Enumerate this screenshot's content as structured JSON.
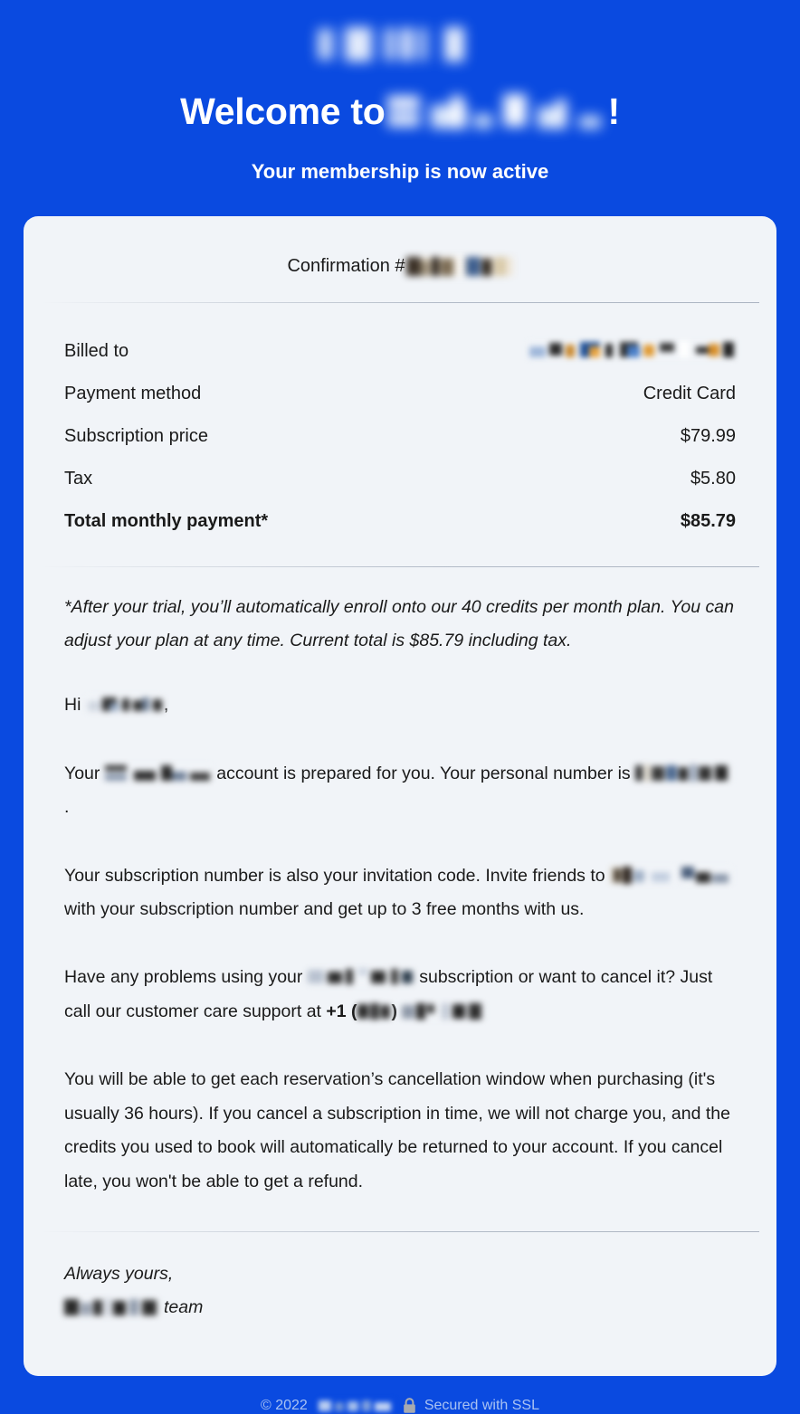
{
  "header": {
    "logo_alt": "brand-logo-redacted",
    "welcome_prefix": "Welcome to ",
    "brand_name_redacted": "",
    "welcome_suffix": "!",
    "subtitle": "Your membership is now active"
  },
  "card": {
    "confirmation_label": "Confirmation #",
    "confirmation_number_redacted": "",
    "billing": {
      "rows": [
        {
          "label": "Billed to",
          "value": "",
          "redacted": true,
          "bold": false
        },
        {
          "label": "Payment method",
          "value": "Credit Card",
          "redacted": false,
          "bold": false
        },
        {
          "label": "Subscription price",
          "value": "$79.99",
          "redacted": false,
          "bold": false
        },
        {
          "label": "Tax",
          "value": "$5.80",
          "redacted": false,
          "bold": false
        },
        {
          "label": "Total monthly payment*",
          "value": "$85.79",
          "redacted": false,
          "bold": true
        }
      ]
    },
    "disclaimer": "*After your trial, you’ll automatically enroll onto our 40 credits per month plan. You can adjust your plan at any time. Current total is $85.79 including tax.",
    "greeting_prefix": "Hi ",
    "greeting_name_redacted": "",
    "greeting_suffix": ",",
    "para_account_1": "Your ",
    "para_account_2": " account is prepared for you. Your personal number is ",
    "para_account_3": ".",
    "para_invite_1": "Your subscription number is also your invitation code. Invite friends to ",
    "para_invite_2": " with your subscription number and get up to 3 free months with us.",
    "para_support_1": "Have any problems using your ",
    "para_support_2": " subscription or want to cancel it? Just call our customer care support at ",
    "para_support_phone_prefix": "+1 (",
    "para_support_phone_mid": ") ",
    "para_cancellation": "You will be able to get each reservation’s cancellation window when purchasing (it's usually 36 hours). If you cancel a subscription in time, we will not charge you, and the credits you used to book will automatically be returned to your account. If you cancel late, you won't be able to get a refund.",
    "signoff_line1": "Always yours,",
    "signoff_team_redacted": "",
    "signoff_line2": "team"
  },
  "footer": {
    "copyright": "© 2022",
    "brand_redacted": "",
    "lock_icon": "lock-icon",
    "ssl_text": "Secured with SSL"
  },
  "colors": {
    "background_blue": "#0a4ae0",
    "card_background": "#f1f4f8",
    "body_text": "#1a1a1a",
    "header_text": "#ffffff",
    "footer_text": "#a9c2f2",
    "lock_gray": "#a7aab0"
  }
}
